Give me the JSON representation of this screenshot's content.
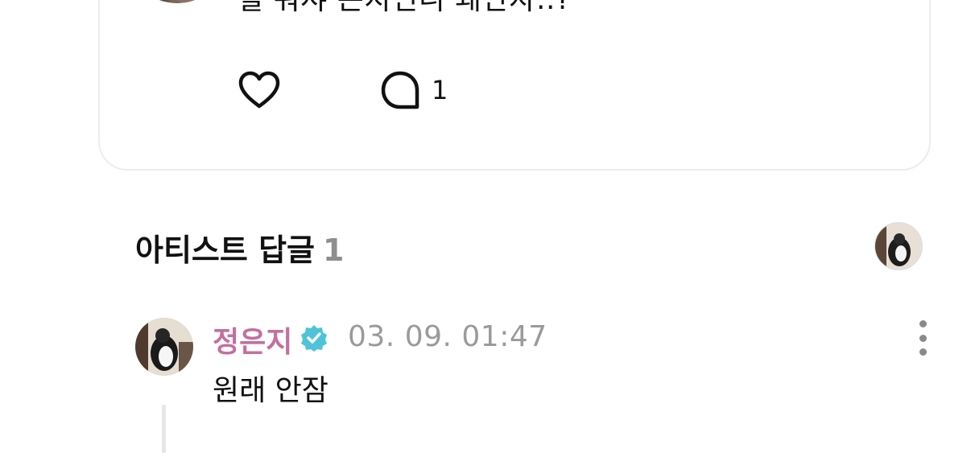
{
  "post": {
    "text": "헐 뭐샤 은지언니 왜안자..?",
    "comment_count": "1"
  },
  "artist_replies": {
    "title": "아티스트 답글",
    "count": "1"
  },
  "reply": {
    "author": "정은지",
    "timestamp": "03. 09. 01:47",
    "text": "원래 안잠"
  },
  "colors": {
    "author_name": "#c46fa0",
    "verified_badge": "#4fc3d9",
    "timestamp": "#9a9a9a",
    "count_gray": "#8e8e8e"
  },
  "icons": [
    "heart-icon",
    "comment-icon",
    "verified-badge-icon",
    "more-vertical-icon"
  ]
}
